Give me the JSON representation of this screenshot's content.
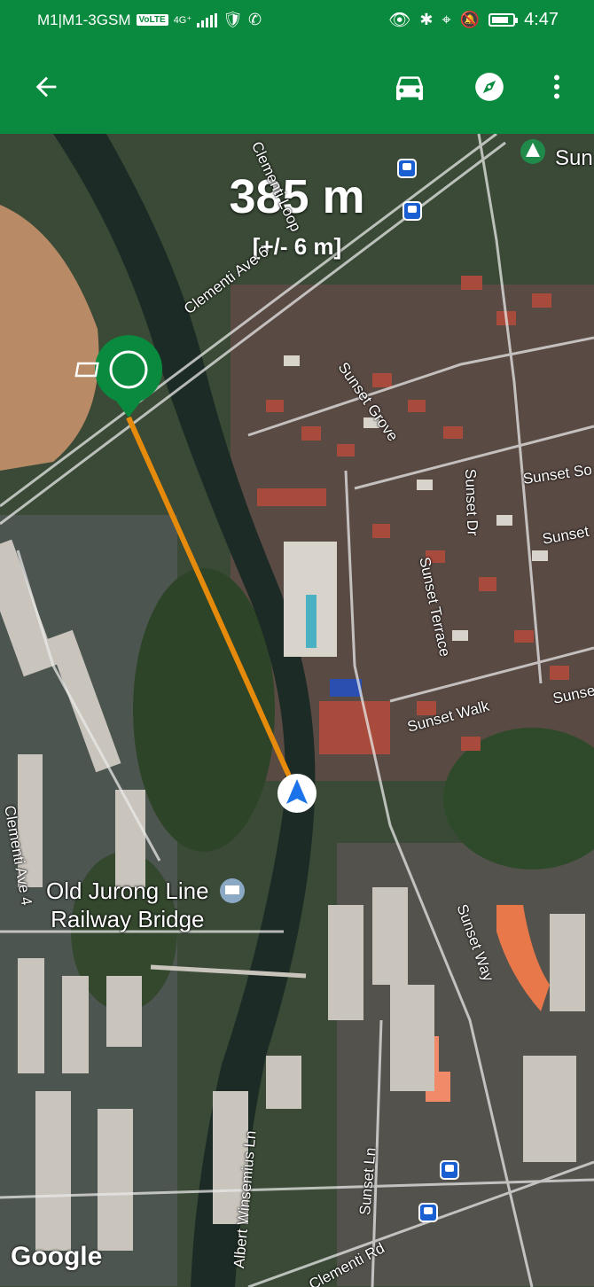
{
  "status_bar": {
    "carrier": "M1|M1-3GSM",
    "volte": "VoLTE",
    "network": "4G⁺",
    "time": "4:47",
    "battery_level": 0.8
  },
  "app_bar": {
    "back_icon": "arrow-left-icon",
    "car_icon": "car-icon",
    "compass_icon": "compass-icon",
    "more_icon": "more-vert-icon"
  },
  "distance": {
    "value": "385 m",
    "accuracy": "[+/- 6 m]"
  },
  "map": {
    "roads": [
      "Clementi Ave 6",
      "Sunset Grove",
      "Sunset Dr",
      "Sunset So",
      "Sunset",
      "Sunset Terrace",
      "Sunset Walk",
      "Sunse",
      "Sunset Way",
      "Clementi Ave 4",
      "Albert Winsemius Ln",
      "Sunset Ln",
      "Clementi Rd",
      "Clementi Loop",
      "Sun"
    ],
    "poi": {
      "name_line1": "Old Jurong Line",
      "name_line2": "Railway Bridge"
    },
    "attribution": "Google",
    "route_color": "#e58a0a",
    "marker_color": "#0a8a3e",
    "location_color": "#1a73e8"
  }
}
